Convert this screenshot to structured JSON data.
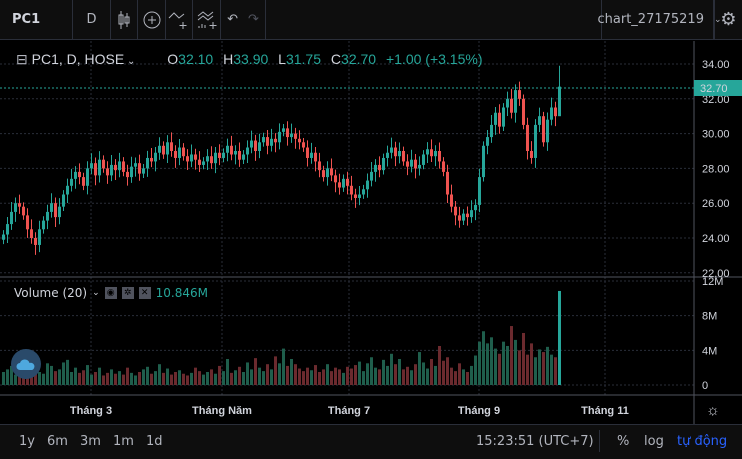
{
  "toolbar": {
    "symbol": "PC1",
    "interval": "D",
    "chart_name": "chart_27175219"
  },
  "legend": {
    "title": "PC1, D, HOSE",
    "o_label": "O",
    "o": "32.10",
    "h_label": "H",
    "h": "33.90",
    "l_label": "L",
    "l": "31.75",
    "c_label": "C",
    "c": "32.70",
    "change": "+1.00 (+3.15%)"
  },
  "volume_legend": {
    "label": "Volume (20)",
    "value": "10.846M"
  },
  "price_axis": {
    "ticks": [
      "34.00",
      "32.00",
      "30.00",
      "28.00",
      "26.00",
      "24.00",
      "22.00"
    ],
    "last": "32.70"
  },
  "volume_axis": {
    "ticks": [
      "12M",
      "8M",
      "4M",
      "0"
    ]
  },
  "time_axis": [
    "Tháng 3",
    "Tháng Năm",
    "Tháng 7",
    "Tháng 9",
    "Tháng 11"
  ],
  "bottom": {
    "ranges": [
      "1y",
      "6m",
      "3m",
      "1m",
      "1d"
    ],
    "time": "15:23:51 (UTC+7)",
    "percent": "%",
    "log": "log",
    "auto": "tự động"
  },
  "colors": {
    "up": "#26a69a",
    "down": "#ef5350",
    "vol_up": "#1f5e4c",
    "vol_down": "#6b2a2e",
    "accent": "#2962ff"
  },
  "chart_data": {
    "type": "candlestick",
    "ylim": [
      22,
      34.6
    ],
    "vol_ylim": [
      0,
      12
    ],
    "close": [
      24.2,
      24.8,
      25.5,
      26.0,
      25.8,
      25.3,
      24.5,
      24.0,
      23.6,
      24.5,
      25.0,
      25.5,
      26.0,
      25.2,
      25.8,
      26.5,
      27.0,
      27.4,
      27.8,
      27.5,
      27.0,
      28.0,
      28.3,
      27.6,
      28.5,
      28.0,
      27.6,
      28.2,
      27.9,
      28.4,
      27.8,
      27.5,
      28.1,
      28.3,
      27.7,
      28.0,
      28.6,
      28.4,
      28.9,
      29.3,
      28.8,
      29.5,
      29.0,
      28.6,
      29.2,
      28.7,
      28.4,
      28.8,
      28.5,
      28.2,
      28.4,
      28.7,
      28.3,
      28.9,
      28.6,
      28.9,
      29.3,
      28.8,
      29.0,
      28.5,
      28.8,
      29.2,
      29.6,
      29.0,
      29.5,
      29.8,
      29.3,
      29.7,
      29.5,
      30.1,
      30.3,
      29.8,
      30.0,
      29.7,
      29.5,
      29.2,
      28.6,
      28.9,
      28.4,
      27.9,
      27.5,
      28.0,
      27.6,
      27.2,
      26.9,
      27.4,
      27.0,
      26.5,
      26.3,
      26.5,
      26.8,
      27.3,
      27.8,
      28.2,
      27.9,
      28.6,
      28.9,
      29.2,
      28.7,
      29.0,
      28.4,
      28.1,
      28.5,
      28.0,
      28.2,
      28.8,
      29.1,
      28.7,
      29.0,
      28.4,
      27.8,
      26.5,
      25.8,
      25.3,
      25.0,
      25.4,
      25.2,
      25.6,
      25.9,
      27.5,
      29.3,
      29.8,
      30.5,
      31.2,
      30.4,
      31.5,
      32.0,
      31.2,
      32.5,
      32.0,
      30.5,
      29.0,
      28.6,
      30.5,
      31.0,
      29.5,
      30.8,
      31.5,
      31.0,
      32.7
    ],
    "volume": [
      1.5,
      1.8,
      2.2,
      1.2,
      1.4,
      2.0,
      1.6,
      2.4,
      2.8,
      1.5,
      1.3,
      2.5,
      2.2,
      1.6,
      1.8,
      2.6,
      2.9,
      1.5,
      2.0,
      1.4,
      1.7,
      2.3,
      1.2,
      1.5,
      2.0,
      1.1,
      1.4,
      1.8,
      1.3,
      1.6,
      1.2,
      2.0,
      1.4,
      1.1,
      1.5,
      1.8,
      2.1,
      1.3,
      1.6,
      2.4,
      1.4,
      1.9,
      1.2,
      1.5,
      1.7,
      1.3,
      1.1,
      1.4,
      2.0,
      1.6,
      1.2,
      1.5,
      1.8,
      1.3,
      2.2,
      1.6,
      3.0,
      1.4,
      1.7,
      2.1,
      1.5,
      2.6,
      1.8,
      3.1,
      2.0,
      1.6,
      2.4,
      1.8,
      3.3,
      2.5,
      4.2,
      2.2,
      3.0,
      2.4,
      1.9,
      1.6,
      2.0,
      1.7,
      2.3,
      1.5,
      1.8,
      2.4,
      1.6,
      2.0,
      1.8,
      1.4,
      2.1,
      1.9,
      2.3,
      2.7,
      1.6,
      2.5,
      3.2,
      2.0,
      1.8,
      2.9,
      2.2,
      3.6,
      2.4,
      3.0,
      1.8,
      2.1,
      1.7,
      2.4,
      3.8,
      2.6,
      1.9,
      3.0,
      2.2,
      4.5,
      2.8,
      3.2,
      2.0,
      1.6,
      2.5,
      1.8,
      1.5,
      2.2,
      3.4,
      5.0,
      6.2,
      4.8,
      5.5,
      4.2,
      3.6,
      5.0,
      4.5,
      6.8,
      5.2,
      4.0,
      6.0,
      3.5,
      4.8,
      3.2,
      4.1,
      3.8,
      4.4,
      3.5,
      3.2,
      10.846
    ]
  }
}
